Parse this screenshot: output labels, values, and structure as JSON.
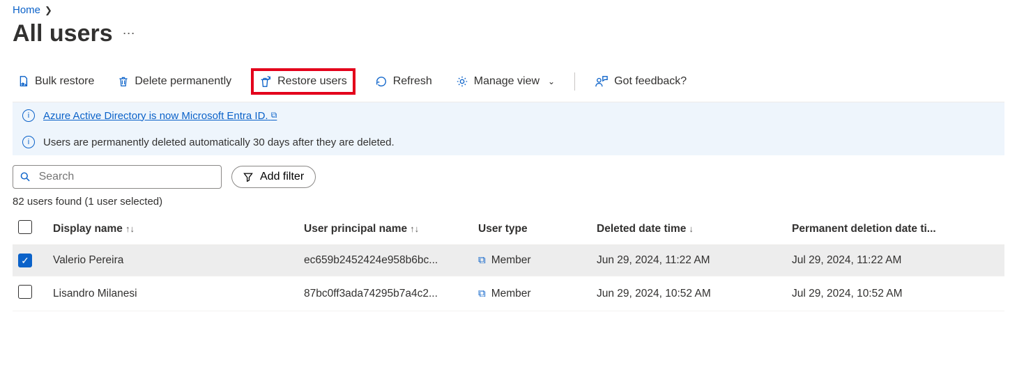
{
  "breadcrumb": {
    "home": "Home"
  },
  "page": {
    "title": "All users",
    "more_aria": "More options"
  },
  "toolbar": {
    "bulk_restore": "Bulk restore",
    "delete_permanently": "Delete permanently",
    "restore_users": "Restore users",
    "refresh": "Refresh",
    "manage_view": "Manage view",
    "got_feedback": "Got feedback?"
  },
  "banners": {
    "rename": "Azure Active Directory is now Microsoft Entra ID.",
    "retention": "Users are permanently deleted automatically 30 days after they are deleted."
  },
  "search": {
    "placeholder": "Search"
  },
  "filters": {
    "add_filter": "Add filter"
  },
  "count_text": "82 users found (1 user selected)",
  "columns": {
    "display_name": "Display name",
    "upn": "User principal name",
    "user_type": "User type",
    "deleted": "Deleted date time",
    "permanent": "Permanent deletion date ti..."
  },
  "rows": [
    {
      "selected": true,
      "display_name": "Valerio Pereira",
      "upn": "ec659b2452424e958b6bc...",
      "user_type": "Member",
      "deleted": "Jun 29, 2024, 11:22 AM",
      "permanent": "Jul 29, 2024, 11:22 AM"
    },
    {
      "selected": false,
      "display_name": "Lisandro Milanesi",
      "upn": "87bc0ff3ada74295b7a4c2...",
      "user_type": "Member",
      "deleted": "Jun 29, 2024, 10:52 AM",
      "permanent": "Jul 29, 2024, 10:52 AM"
    }
  ]
}
